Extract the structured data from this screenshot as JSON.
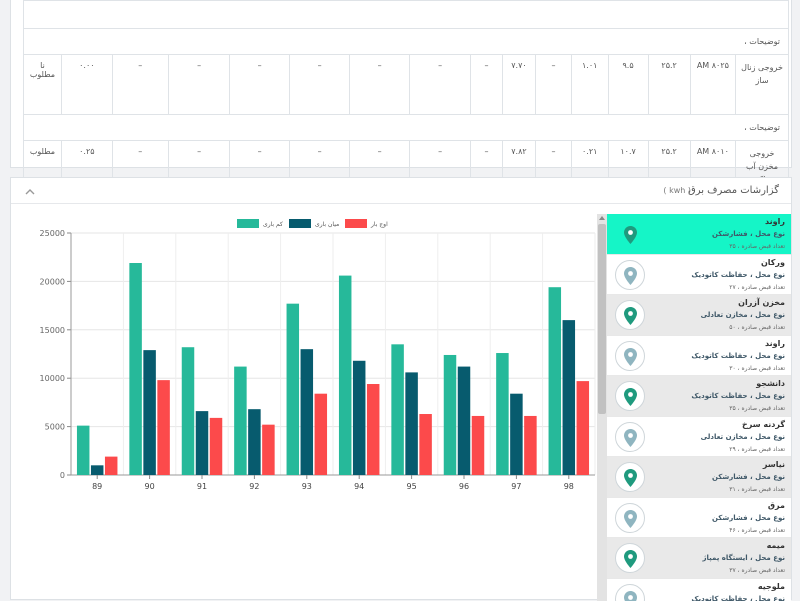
{
  "table": {
    "desc_label": "توضیحات ،",
    "rows": [
      {
        "name": "خروجی زنال ساز",
        "time": "۸۰۲۵ AM",
        "c1": "۲۵.۲",
        "c2": "۹.۵",
        "c3": "۱.۰۱",
        "c4": "–",
        "c5": "۷.۷۰",
        "c6": "–",
        "c7": "–",
        "c8": "–",
        "c9": "–",
        "c10": "–",
        "c11": "–",
        "c12": "–",
        "c13": "۰.۰۰",
        "status": "نا مطلوب"
      },
      {
        "name": "خروجی مخزن آب پاک",
        "time": "۸۰۱۰ AM",
        "c1": "۲۵.۲",
        "c2": "۱۰.۷",
        "c3": "۰.۲۱",
        "c4": "–",
        "c5": "۷.۸۲",
        "c6": "–",
        "c7": "–",
        "c8": "–",
        "c9": "–",
        "c10": "–",
        "c11": "–",
        "c12": "–",
        "c13": "۰.۲۵",
        "status": "مطلوب"
      }
    ]
  },
  "report": {
    "title": "گزارشات مصرف برق",
    "unit": "( kwh )"
  },
  "chart_data": {
    "type": "bar",
    "categories": [
      "89",
      "90",
      "91",
      "92",
      "93",
      "94",
      "95",
      "96",
      "97",
      "98"
    ],
    "series": [
      {
        "name": "کم باری",
        "color": "#26b99a",
        "values": [
          5100,
          21900,
          13200,
          11200,
          17700,
          20600,
          13500,
          12400,
          12600,
          19400
        ]
      },
      {
        "name": "میان باری",
        "color": "#075b6e",
        "values": [
          1000,
          12900,
          6600,
          6800,
          13000,
          11800,
          10600,
          11200,
          8400,
          16000
        ]
      },
      {
        "name": "اوج بار",
        "color": "#fc4a4b",
        "values": [
          1900,
          9800,
          5900,
          5200,
          8400,
          9400,
          6300,
          6100,
          6100,
          9700
        ]
      }
    ],
    "ylim": [
      0,
      25000
    ],
    "yticks": [
      "0",
      "5000",
      "10000",
      "15000",
      "20000",
      "25000"
    ],
    "legend": "top",
    "grid": true
  },
  "sites": [
    {
      "name": "راوند",
      "type": "نوع محل ، فشارشکن",
      "count": "تعداد قبض صادره ، ۳۵"
    },
    {
      "name": "ورکان",
      "type": "نوع محل ، حفاظت کاتودیک",
      "count": "تعداد قبض صادره ، ۲۷"
    },
    {
      "name": "مخزن آزران",
      "type": "نوع محل ، مخازن تعادلی",
      "count": "تعداد قبض صادره ، ۵۰"
    },
    {
      "name": "راوند",
      "type": "نوع محل ، حفاظت کاتودیک",
      "count": "تعداد قبض صادره ، ۳۰"
    },
    {
      "name": "دانشجو",
      "type": "نوع محل ، حفاظت کاتودیک",
      "count": "تعداد قبض صادره ، ۳۵"
    },
    {
      "name": "گردنه سرخ",
      "type": "نوع محل ، مخازن تعادلی",
      "count": "تعداد قبض صادره ، ۲۹"
    },
    {
      "name": "نیاسر",
      "type": "نوع محل ، فشارشکن",
      "count": "تعداد قبض صادره ، ۳۱"
    },
    {
      "name": "مرق",
      "type": "نوع محل ، فشارشکن",
      "count": "تعداد قبض صادره ، ۴۶"
    },
    {
      "name": "میمه",
      "type": "نوع محل ، ایستگاه پمپاژ",
      "count": "تعداد قبض صادره ، ۳۷"
    },
    {
      "name": "ملوجیه",
      "type": "نوع محل ، حفاظت کاتودیک",
      "count": ""
    }
  ],
  "colors": {
    "accent": "#15f5c7",
    "pin_dark": "#1f9a7e",
    "pin_light": "#8fb5c0"
  },
  "icons": {
    "pin": "map-pin-icon",
    "collapse": "chevron-up-icon"
  }
}
